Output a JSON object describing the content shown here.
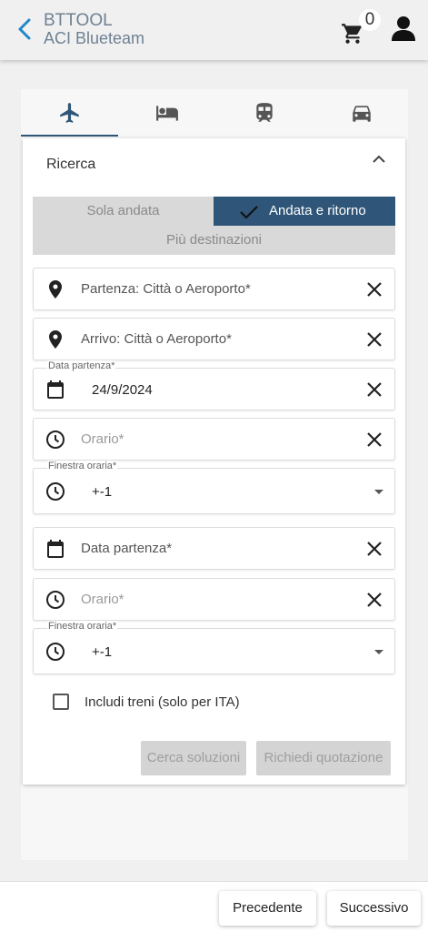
{
  "app": {
    "title": "BTTOOL",
    "subtitle": "ACI Blueteam",
    "cart_count": "0"
  },
  "tabs": [
    {
      "name": "flights",
      "icon": "airplane-icon"
    },
    {
      "name": "hotels",
      "icon": "bed-icon"
    },
    {
      "name": "trains",
      "icon": "train-icon"
    },
    {
      "name": "cars",
      "icon": "car-icon"
    }
  ],
  "search": {
    "title": "Ricerca",
    "trip_type": {
      "one_way": "Sola andata",
      "round_trip": "Andata e ritorno",
      "multi": "Più destinazioni",
      "selected": "Andata e ritorno"
    },
    "departure_placeholder": "Partenza: Città o Aeroporto*",
    "arrival_placeholder": "Arrivo: Città o Aeroporto*",
    "departure_date_label": "Data partenza*",
    "departure_date_value": "24/9/2024",
    "time_placeholder": "Orario*",
    "window_label": "Finestra oraria*",
    "window_value": "+-1",
    "return_date_placeholder": "Data partenza*",
    "return_time_placeholder": "Orario*",
    "return_window_label": "Finestra oraria*",
    "return_window_value": "+-1",
    "include_trains_label": "Includi treni (solo per ITA)",
    "search_button": "Cerca soluzioni",
    "quote_button": "Richiedi quotazione"
  },
  "footer": {
    "prev_label": "Precedente",
    "next_label": "Successivo"
  },
  "colors": {
    "accent": "#2f5678",
    "back_arrow": "#1e88c9"
  }
}
